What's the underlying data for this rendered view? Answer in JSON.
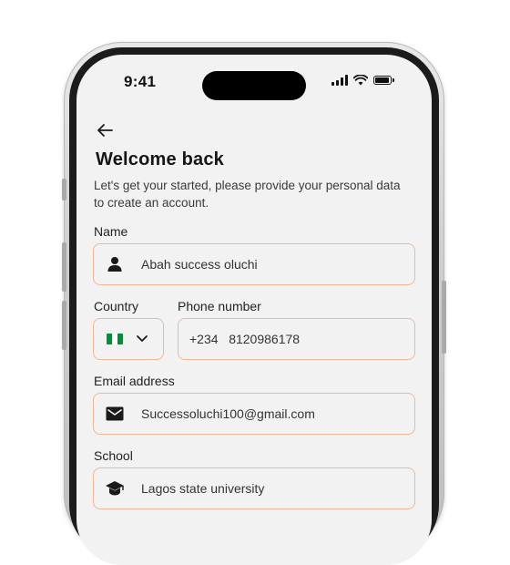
{
  "status_bar": {
    "time": "9:41"
  },
  "header": {
    "title": "Welcome back",
    "subtitle": "Let's get your started, please provide your personal data to create an account."
  },
  "form": {
    "name": {
      "label": "Name",
      "value": "Abah success oluchi",
      "icon": "person-icon"
    },
    "country": {
      "label": "Country",
      "flag_colors": [
        "#0a8a3c",
        "#ffffff",
        "#0a8a3c"
      ],
      "icon": "chevron-down-icon"
    },
    "phone": {
      "label": "Phone number",
      "value": "+234   8120986178"
    },
    "email": {
      "label": "Email address",
      "value": "Successoluchi100@gmail.com",
      "icon": "mail-icon"
    },
    "school": {
      "label": "School",
      "value": "Lagos state university",
      "icon": "graduation-cap-icon"
    }
  },
  "colors": {
    "field_border": "#f0b895",
    "screen_bg": "#f2f2f2",
    "text": "#161616"
  }
}
